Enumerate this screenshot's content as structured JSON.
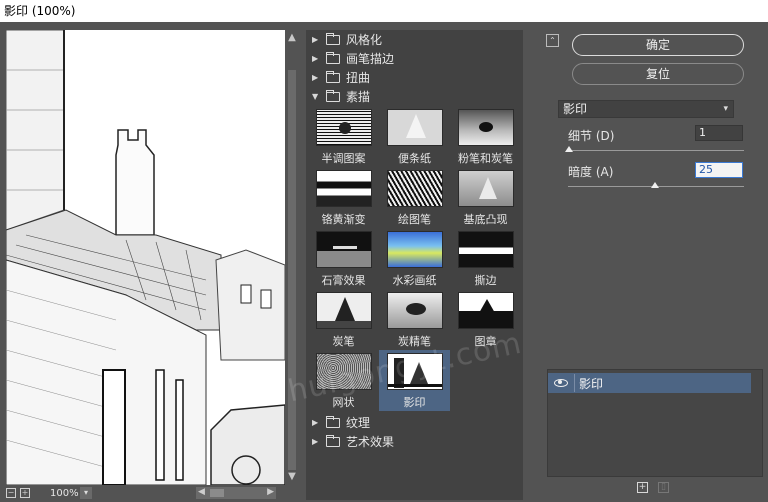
{
  "window": {
    "title": "影印 (100%)"
  },
  "preview": {
    "zoom": "100%",
    "zoom_out_icon": "minus-square-icon",
    "zoom_in_icon": "plus-square-icon"
  },
  "gallery": {
    "categories_top": [
      {
        "label": "风格化",
        "expanded": false
      },
      {
        "label": "画笔描边",
        "expanded": false
      },
      {
        "label": "扭曲",
        "expanded": false
      },
      {
        "label": "素描",
        "expanded": true
      }
    ],
    "thumbnails": [
      {
        "label": "半调图案",
        "selected": false
      },
      {
        "label": "便条纸",
        "selected": false
      },
      {
        "label": "粉笔和炭笔",
        "selected": false
      },
      {
        "label": "铬黄渐变",
        "selected": false
      },
      {
        "label": "绘图笔",
        "selected": false
      },
      {
        "label": "基底凸现",
        "selected": false
      },
      {
        "label": "石膏效果",
        "selected": false
      },
      {
        "label": "水彩画纸",
        "selected": false
      },
      {
        "label": "撕边",
        "selected": false
      },
      {
        "label": "炭笔",
        "selected": false
      },
      {
        "label": "炭精笔",
        "selected": false
      },
      {
        "label": "图章",
        "selected": false
      },
      {
        "label": "网状",
        "selected": false
      },
      {
        "label": "影印",
        "selected": true
      }
    ],
    "categories_bottom": [
      {
        "label": "纹理",
        "expanded": false
      },
      {
        "label": "艺术效果",
        "expanded": false
      }
    ]
  },
  "actions": {
    "ok_label": "确定",
    "reset_label": "复位"
  },
  "settings": {
    "filter_select": "影印",
    "params": [
      {
        "label": "细节 (D)",
        "value": "1",
        "slider_fraction": 0.0
      },
      {
        "label": "暗度 (A)",
        "value": "25",
        "slider_fraction": 0.5
      }
    ]
  },
  "layers": {
    "items": [
      {
        "name": "影印",
        "visible": true
      }
    ]
  },
  "watermark": "huigongyt.com"
}
